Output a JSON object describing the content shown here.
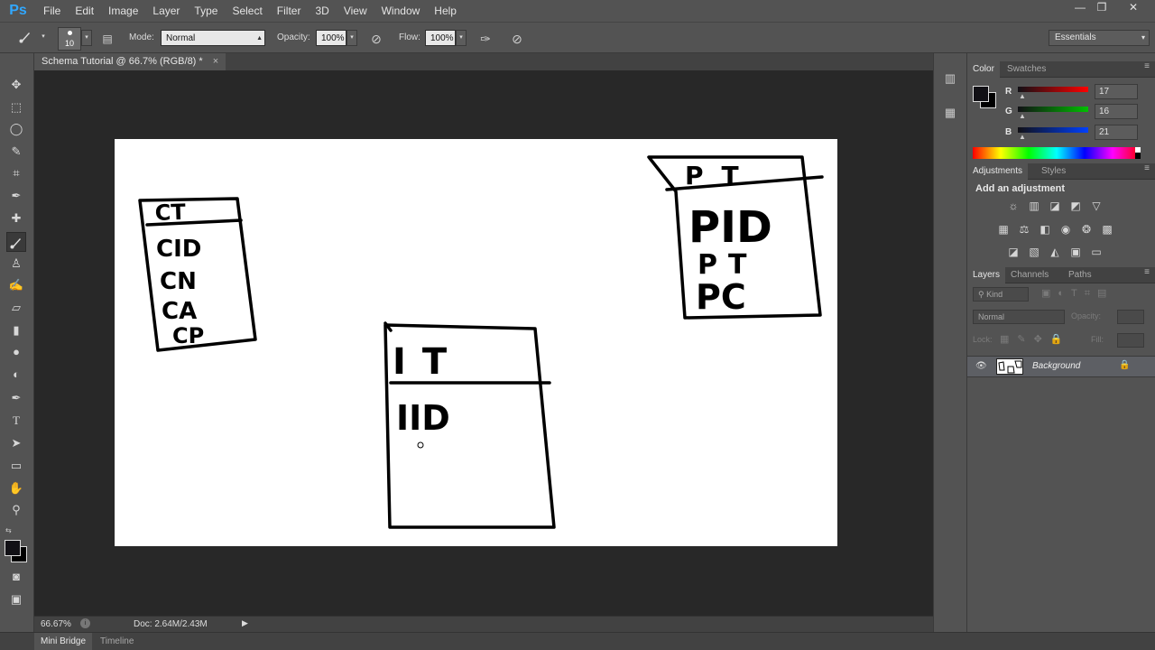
{
  "app": {
    "logo": "Ps",
    "window_controls": [
      "—",
      "❐",
      "✕"
    ]
  },
  "menu": [
    "File",
    "Edit",
    "Image",
    "Layer",
    "Type",
    "Select",
    "Filter",
    "3D",
    "View",
    "Window",
    "Help"
  ],
  "options": {
    "brush_size": "10",
    "mode_label": "Mode:",
    "mode_value": "Normal",
    "opacity_label": "Opacity:",
    "opacity_value": "100%",
    "flow_label": "Flow:",
    "flow_value": "100%",
    "workspace": "Essentials"
  },
  "document": {
    "tab_title": "Schema Tutorial @ 66.7% (RGB/8) *",
    "close": "×",
    "zoom": "66.67%",
    "doc_info": "Doc: 2.64M/2.43M",
    "drawings": [
      {
        "header": "CT",
        "fields": [
          "CID",
          "CN",
          "CA",
          "CP"
        ]
      },
      {
        "header": "IT",
        "fields": [
          "IID"
        ]
      },
      {
        "header": "PT",
        "fields": [
          "PID",
          "PT",
          "PC"
        ]
      }
    ]
  },
  "bottom_tabs": [
    "Mini Bridge",
    "Timeline"
  ],
  "color_panel": {
    "tabs": [
      "Color",
      "Swatches"
    ],
    "channels": [
      {
        "label": "R",
        "value": "17",
        "color": "#ff0000"
      },
      {
        "label": "G",
        "value": "16",
        "color": "#00c000"
      },
      {
        "label": "B",
        "value": "21",
        "color": "#0040ff"
      }
    ],
    "foreground": "#111015",
    "background": "#000000"
  },
  "adjustments_panel": {
    "tabs": [
      "Adjustments",
      "Styles"
    ],
    "heading": "Add an adjustment"
  },
  "layers_panel": {
    "tabs": [
      "Layers",
      "Channels",
      "Paths"
    ],
    "filter_kind": "Kind",
    "blend_mode": "Normal",
    "opacity_label": "Opacity:",
    "lock_label": "Lock:",
    "fill_label": "Fill:",
    "layers": [
      {
        "name": "Background",
        "visible": true,
        "locked": true
      }
    ]
  }
}
